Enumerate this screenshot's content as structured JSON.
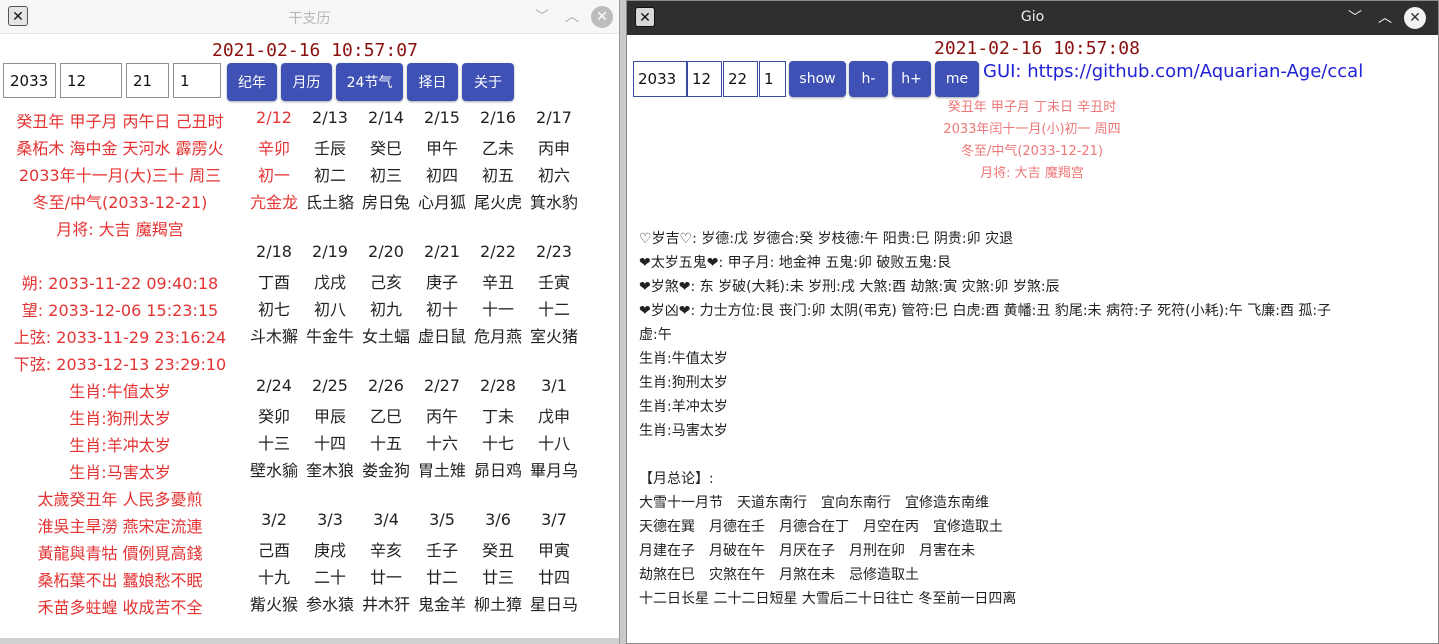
{
  "left_window": {
    "title": "干支历",
    "icon": "x-app-icon",
    "datetime": "2021-02-16 10:57:07",
    "inputs": [
      "2033",
      "12",
      "21",
      "1"
    ],
    "buttons": [
      "纪年",
      "月历",
      "24节气",
      "择日",
      "关于"
    ],
    "info_lines": [
      "癸丑年 甲子月 丙午日 己丑时",
      "桑柘木 海中金 天河水 霹雳火",
      "2033年十一月(大)三十 周三",
      "冬至/中气(2033-12-21)",
      "月将: 大吉 魔羯宫",
      "",
      "朔: 2033-11-22 09:40:18",
      "望: 2033-12-06 15:23:15",
      "上弦: 2033-11-29 23:16:24",
      "下弦: 2033-12-13 23:29:10",
      "生肖:牛值太岁",
      "生肖:狗刑太岁",
      "生肖:羊冲太岁",
      "生肖:马害太岁",
      "太歲癸丑年 人民多憂煎",
      "淮吳主旱澇 燕宋定流連",
      "黃龍與青牯 價例覓高錢",
      "桑柘葉不出 蠶娘愁不眠",
      "禾苗多蛀蝗 收成苦不全"
    ],
    "calendar": [
      {
        "dates": [
          "2/12",
          "2/13",
          "2/14",
          "2/15",
          "2/16",
          "2/17"
        ],
        "ganzhi": [
          "辛卯",
          "壬辰",
          "癸巳",
          "甲午",
          "乙未",
          "丙申"
        ],
        "lunar": [
          "初一",
          "初二",
          "初三",
          "初四",
          "初五",
          "初六"
        ],
        "xiu": [
          "亢金龙",
          "氐土貉",
          "房日兔",
          "心月狐",
          "尾火虎",
          "箕水豹"
        ]
      },
      {
        "dates": [
          "2/18",
          "2/19",
          "2/20",
          "2/21",
          "2/22",
          "2/23"
        ],
        "ganzhi": [
          "丁酉",
          "戊戌",
          "己亥",
          "庚子",
          "辛丑",
          "壬寅"
        ],
        "lunar": [
          "初七",
          "初八",
          "初九",
          "初十",
          "十一",
          "十二"
        ],
        "xiu": [
          "斗木獬",
          "牛金牛",
          "女土蝠",
          "虚日鼠",
          "危月燕",
          "室火猪"
        ]
      },
      {
        "dates": [
          "2/24",
          "2/25",
          "2/26",
          "2/27",
          "2/28",
          "3/1"
        ],
        "ganzhi": [
          "癸卯",
          "甲辰",
          "乙巳",
          "丙午",
          "丁未",
          "戊申"
        ],
        "lunar": [
          "十三",
          "十四",
          "十五",
          "十六",
          "十七",
          "十八"
        ],
        "xiu": [
          "壁水貐",
          "奎木狼",
          "娄金狗",
          "胃土雉",
          "昴日鸡",
          "畢月乌"
        ]
      },
      {
        "dates": [
          "3/2",
          "3/3",
          "3/4",
          "3/5",
          "3/6",
          "3/7"
        ],
        "ganzhi": [
          "己酉",
          "庚戌",
          "辛亥",
          "壬子",
          "癸丑",
          "甲寅"
        ],
        "lunar": [
          "十九",
          "二十",
          "廿一",
          "廿二",
          "廿三",
          "廿四"
        ],
        "xiu": [
          "觜火猴",
          "参水猿",
          "井木犴",
          "鬼金羊",
          "柳土獐",
          "星日马"
        ]
      }
    ]
  },
  "right_window": {
    "title": "Gio",
    "icon": "x-app-icon",
    "datetime": "2021-02-16 10:57:08",
    "inputs": [
      "2033",
      "12",
      "22",
      "1"
    ],
    "buttons": [
      "show",
      "h-",
      "h+",
      "me"
    ],
    "link": "GUI: https://github.com/Aquarian-Age/ccal",
    "summary": [
      "癸丑年 甲子月 丁未日 辛丑时",
      "2033年闰十一月(小)初一 周四",
      "冬至/中气(2033-12-21)",
      "月将: 大吉 魔羯宫"
    ],
    "body_lines": [
      "♡岁吉♡: 岁德:戊 岁德合:癸 岁枝德:午 阳贵:巳 阴贵:卯 灾退",
      "❤太岁五鬼❤: 甲子月: 地金神 五鬼:卯 破败五鬼:艮",
      "❤岁煞❤: 东 岁破(大耗):未 岁刑:戌 大煞:酉 劫煞:寅 灾煞:卯 岁煞:辰",
      "❤岁凶❤: 力士方位:艮 丧门:卯 太阴(弔克) 管符:巳 白虎:酉 黄幡:丑 豹尾:未 病符:子 死符(小耗):午 飞廉:酉 孤:子",
      "虚:午",
      "生肖:牛值太岁",
      "生肖:狗刑太岁",
      "生肖:羊冲太岁",
      "生肖:马害太岁",
      "",
      "【月总论】:",
      "大雪十一月节　天道东南行　宜向东南行　宜修造东南维",
      "天德在巽　月德在壬　月德合在丁　月空在丙　宜修造取土",
      "月建在子　月破在午　月厌在子　月刑在卯　月害在未",
      "劫煞在巳　灾煞在午　月煞在未　忌修造取土",
      "十二日长星 二十二日短星 大雪后二十日往亡 冬至前一日四离"
    ]
  }
}
